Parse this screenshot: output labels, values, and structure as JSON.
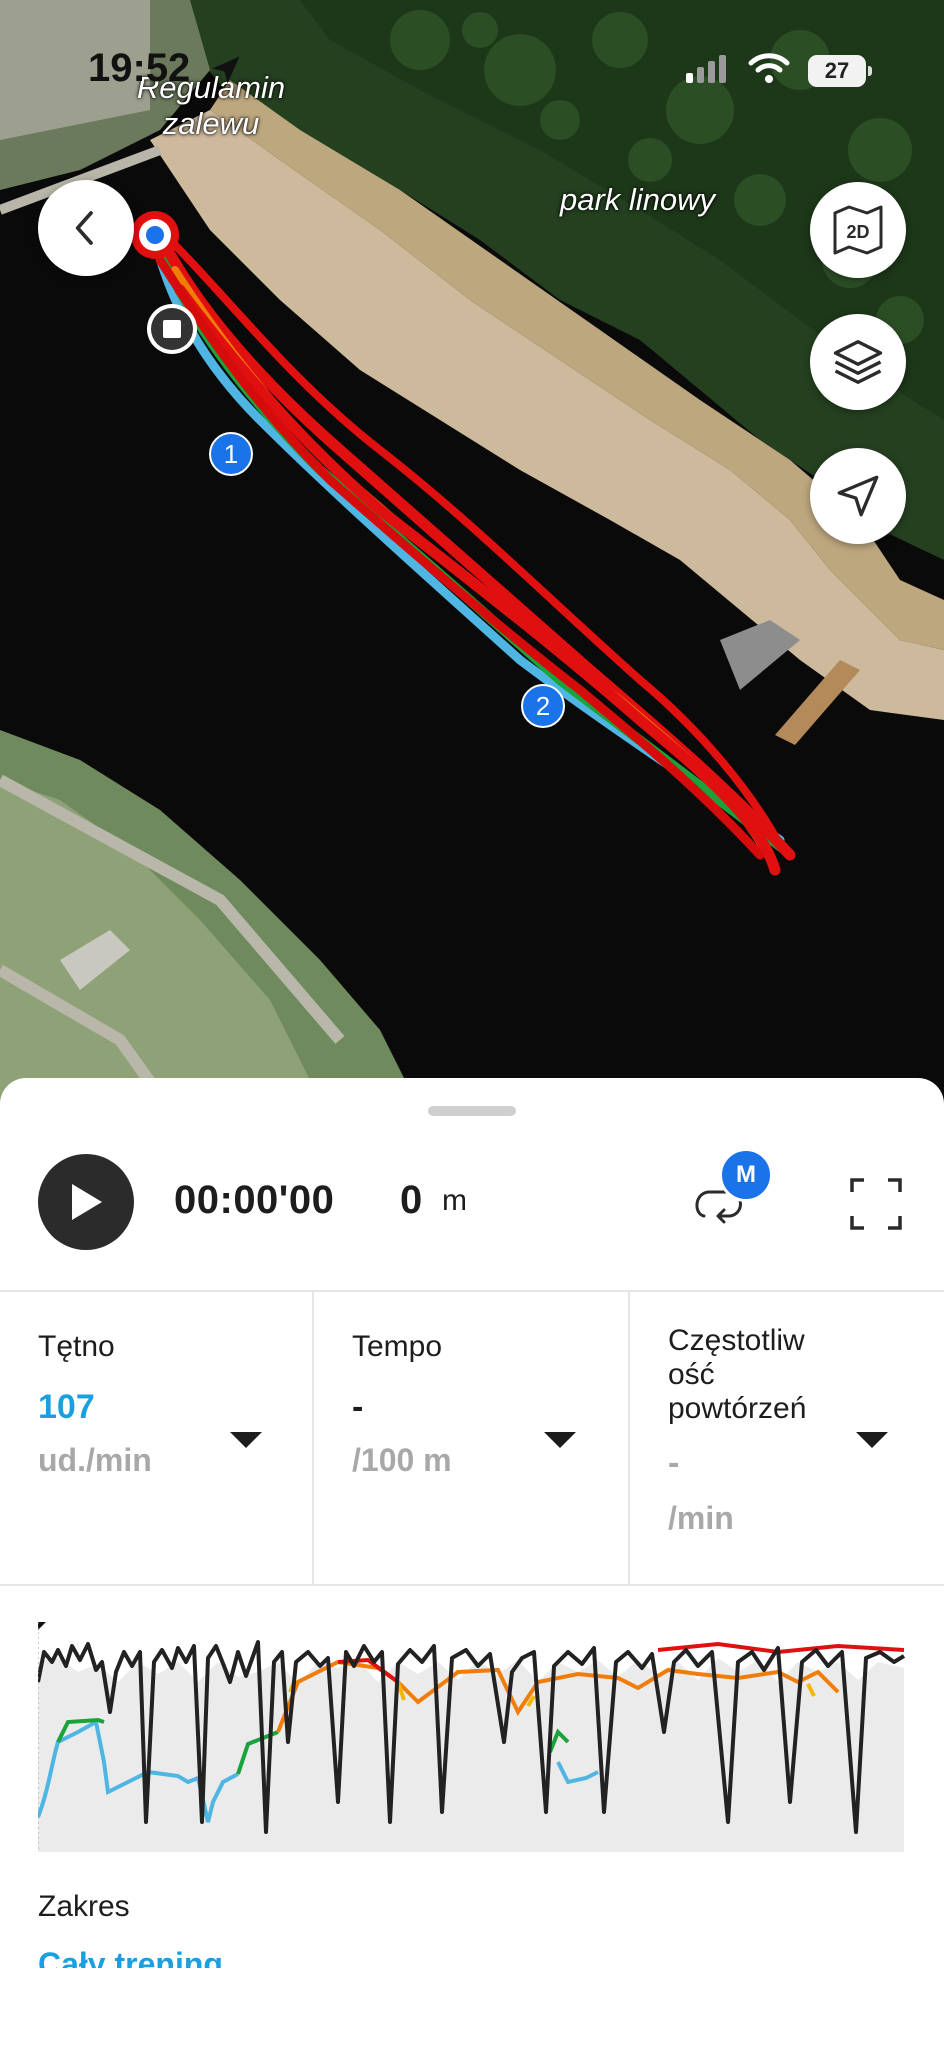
{
  "status_bar": {
    "time": "19:52",
    "battery": "27"
  },
  "map": {
    "labels": {
      "regulamin_line1": "Regulamin",
      "regulamin_line2": "zalewu",
      "park": "park linowy"
    },
    "lap_markers": [
      "1",
      "2"
    ],
    "buttons": {
      "view_mode": "2D"
    }
  },
  "player": {
    "time": "00:00'00",
    "distance_value": "0",
    "distance_unit": "m",
    "badge": "M"
  },
  "metrics": [
    {
      "label": "Tętno",
      "value": "107",
      "unit": "ud./min",
      "value_color": "#1aa0e0"
    },
    {
      "label": "Tempo",
      "value": "-",
      "unit": "/100 m",
      "value_color": "#1d1d1d"
    },
    {
      "label": "Częstotliw ość powtórzeń",
      "label_lines": [
        "Częstotliw",
        "ość",
        "powtórzeń"
      ],
      "value": "-",
      "unit": "/min",
      "value_color": "#a8a8a8"
    }
  ],
  "range": {
    "label": "Zakres",
    "value": "Cały trening"
  },
  "colors": {
    "accent_blue": "#1aa0e0",
    "badge_blue": "#1a73e8",
    "zone_blue": "#4fb6e4",
    "zone_green": "#1aa33a",
    "zone_yellow": "#f2b705",
    "zone_orange": "#f07d0a",
    "zone_red": "#e11010"
  }
}
